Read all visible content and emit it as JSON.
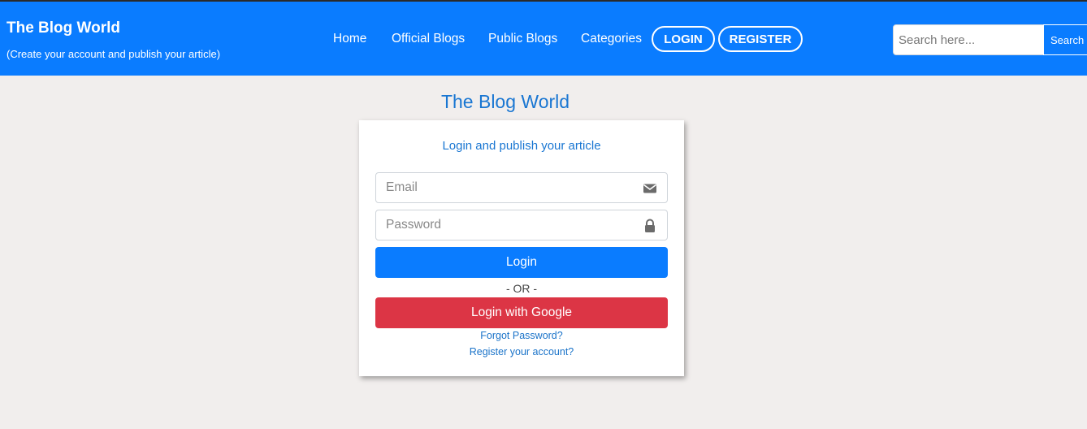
{
  "brand": {
    "title": "The Blog World",
    "subtitle": "(Create your account and publish your article)"
  },
  "nav": {
    "links": [
      "Home",
      "Official Blogs",
      "Public Blogs",
      "Categories"
    ],
    "login_label": "LOGIN",
    "register_label": "REGISTER"
  },
  "search": {
    "placeholder": "Search here...",
    "value": "",
    "button_label": "Search"
  },
  "main": {
    "heading": "The Blog World",
    "card": {
      "subtitle": "Login and publish your article",
      "email_placeholder": "Email",
      "password_placeholder": "Password",
      "login_button": "Login",
      "or_text": "- OR -",
      "google_button": "Login with Google",
      "forgot_link": "Forgot Password?",
      "register_link": "Register your account?"
    }
  },
  "icons": {
    "email": "envelope-icon",
    "password": "lock-icon"
  },
  "colors": {
    "primary": "#0a7cff",
    "danger": "#dc3545",
    "background": "#f1eeed",
    "heading": "#1976d2"
  }
}
